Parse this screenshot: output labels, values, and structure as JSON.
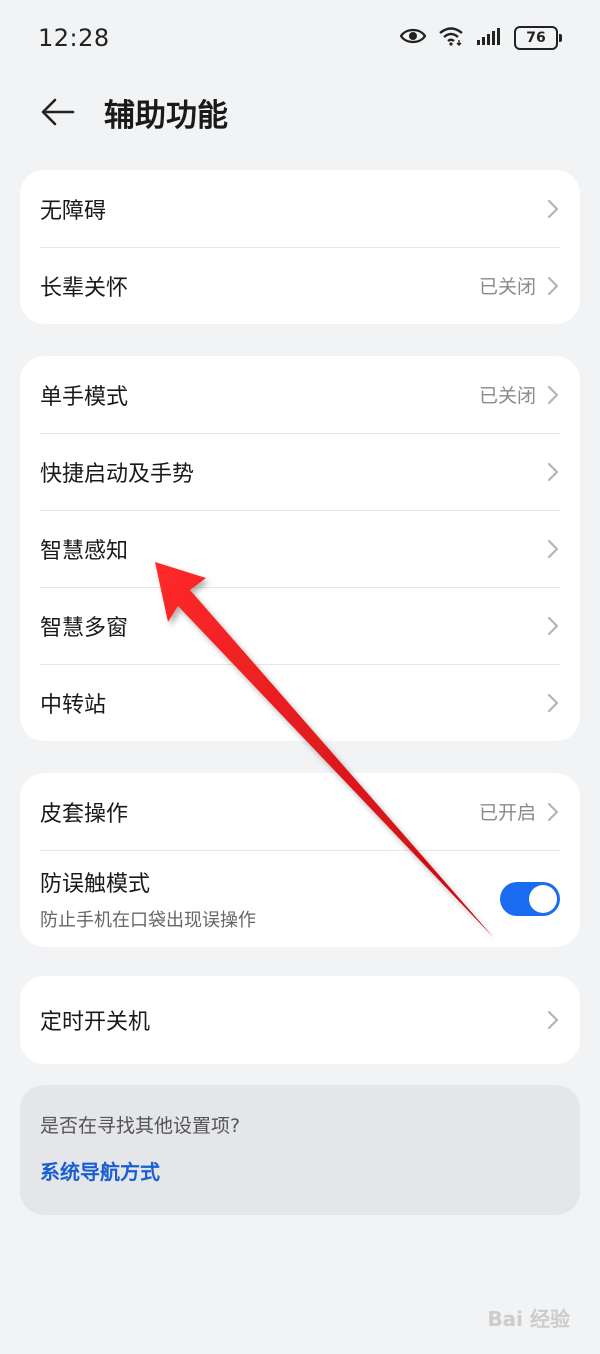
{
  "status_bar": {
    "time": "12:28",
    "battery": "76",
    "icons": [
      "eye-icon",
      "wifi-icon",
      "signal-icon",
      "battery-icon"
    ]
  },
  "header": {
    "title": "辅助功能",
    "back_icon": "back-arrow-icon"
  },
  "cards": [
    {
      "rows": [
        {
          "label": "无障碍",
          "value": ""
        },
        {
          "label": "长辈关怀",
          "value": "已关闭"
        }
      ]
    },
    {
      "rows": [
        {
          "label": "单手模式",
          "value": "已关闭"
        },
        {
          "label": "快捷启动及手势",
          "value": ""
        },
        {
          "label": "智慧感知",
          "value": ""
        },
        {
          "label": "智慧多窗",
          "value": ""
        },
        {
          "label": "中转站",
          "value": ""
        }
      ]
    },
    {
      "rows": [
        {
          "label": "皮套操作",
          "value": "已开启"
        },
        {
          "label": "防误触模式",
          "sub": "防止手机在口袋出现误操作",
          "toggle": true
        }
      ]
    },
    {
      "rows": [
        {
          "label": "定时开关机",
          "value": ""
        }
      ]
    }
  ],
  "suggestion": {
    "question": "是否在寻找其他设置项?",
    "link": "系统导航方式"
  },
  "annotation": {
    "arrow_color": "#e8141c"
  },
  "colors": {
    "background": "#f1f3f5",
    "accent": "#1a6df0",
    "link": "#1a5fd1"
  },
  "watermark": "Bai 经验"
}
